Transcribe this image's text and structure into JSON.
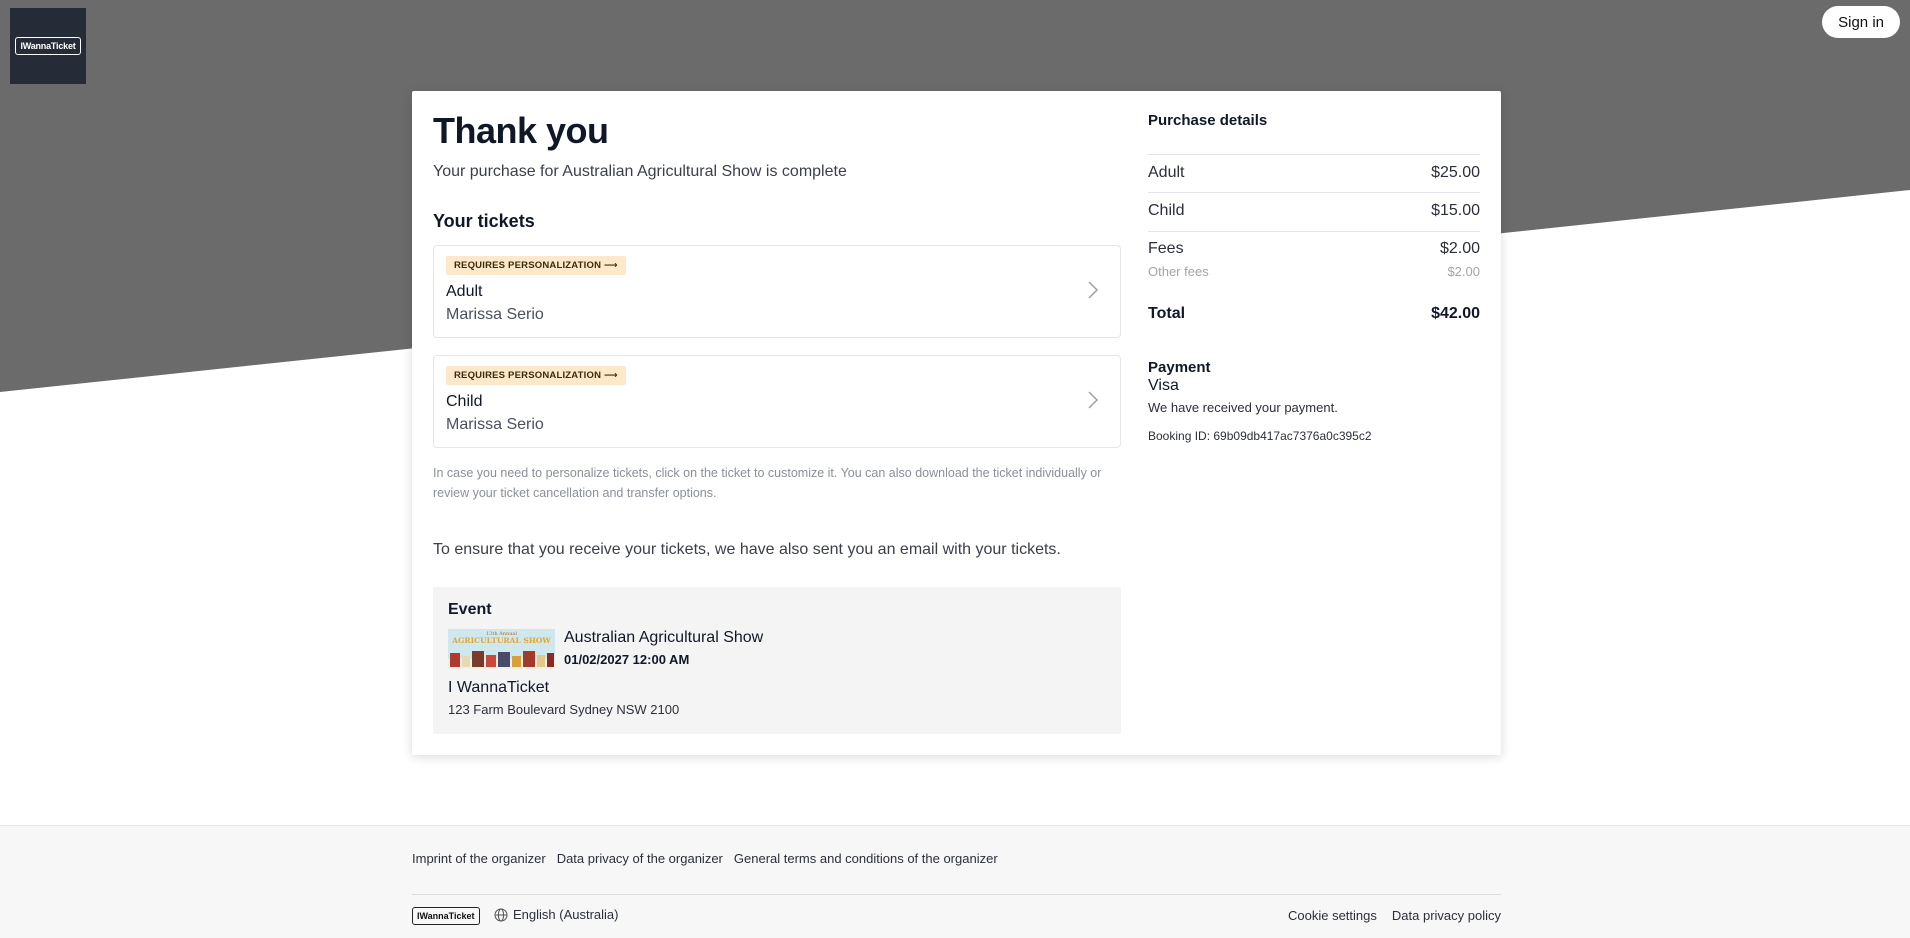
{
  "header": {
    "logo_text": "IWannaTicket",
    "signin_label": "Sign in"
  },
  "main": {
    "title": "Thank you",
    "subtitle": "Your purchase for Australian Agricultural Show is complete",
    "tickets_heading": "Your tickets",
    "tickets": [
      {
        "badge": "REQUIRES PERSONALIZATION ⟶",
        "name": "Adult",
        "holder": "Marissa Serio"
      },
      {
        "badge": "REQUIRES PERSONALIZATION ⟶",
        "name": "Child",
        "holder": "Marissa Serio"
      }
    ],
    "hint": "In case you need to personalize tickets, click on the ticket to customize it. You can also download the ticket individually or review your ticket cancellation and transfer options.",
    "email_note": "To ensure that you receive your tickets, we have also sent you an email with your tickets.",
    "event": {
      "heading": "Event",
      "name": "Australian Agricultural Show",
      "datetime": "01/02/2027 12:00 AM",
      "organizer": "I WannaTicket",
      "address": "123 Farm Boulevard Sydney NSW 2100",
      "thumb_top_text": "13th Annual",
      "thumb_title": "AGRICULTURAL SHOW"
    }
  },
  "purchase": {
    "title": "Purchase details",
    "rows": [
      {
        "label": "Adult",
        "value": "$25.00"
      },
      {
        "label": "Child",
        "value": "$15.00"
      },
      {
        "label": "Fees",
        "value": "$2.00"
      }
    ],
    "other_fees": {
      "label": "Other fees",
      "value": "$2.00"
    },
    "total": {
      "label": "Total",
      "value": "$42.00"
    },
    "payment_title": "Payment",
    "payment_method": "Visa",
    "payment_note": "We have received your payment.",
    "booking_id": "Booking ID: 69b09db417ac7376a0c395c2"
  },
  "footer": {
    "links": [
      "Imprint of the organizer",
      "Data privacy of the organizer",
      "General terms and conditions of the organizer"
    ],
    "brand": "IWannaTicket",
    "language": "English (Australia)",
    "right_links": [
      "Cookie settings",
      "Data privacy policy"
    ]
  },
  "colors": {
    "banner": "#6b6b6b",
    "logo_bg": "#252b37",
    "badge_bg": "#fde9c9",
    "event_box_bg": "#f4f4f5"
  }
}
